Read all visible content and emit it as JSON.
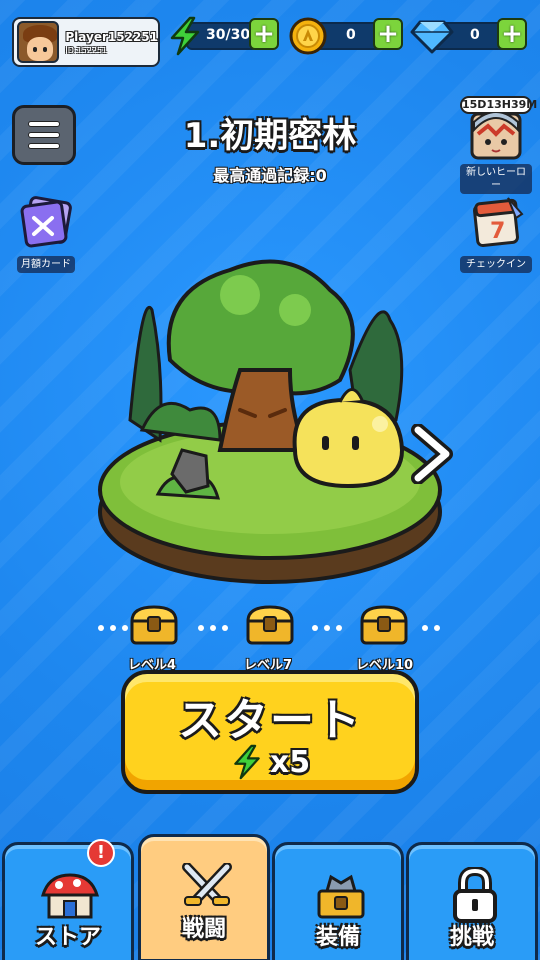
{
  "player": {
    "name": "Player152251",
    "id": "ID:152251"
  },
  "resources": {
    "energy": {
      "value": "30/30",
      "icon": "lightning-icon"
    },
    "gold": {
      "value": "0",
      "icon": "coin-icon"
    },
    "gems": {
      "value": "0",
      "icon": "diamond-icon"
    },
    "plus": "+"
  },
  "stage": {
    "title": "1.初期密林",
    "subtitle": "最高通過記録:0"
  },
  "side_left": {
    "monthly_card": "月額カード"
  },
  "side_right": {
    "timer": "15D13H39M",
    "new_hero": "新しいヒーロー",
    "checkin": "チェックイン"
  },
  "level_track": {
    "levels": [
      "レベル4",
      "レベル7",
      "レベル10"
    ]
  },
  "start_button": {
    "label": "スタート",
    "cost": "x5"
  },
  "nav": {
    "tabs": [
      {
        "label": "ストア",
        "icon": "shop-icon",
        "active": false,
        "alert": "!"
      },
      {
        "label": "戦闘",
        "icon": "crossed-swords-icon",
        "active": true
      },
      {
        "label": "装備",
        "icon": "equipment-chest-icon",
        "active": false
      },
      {
        "label": "挑戦",
        "icon": "lock-icon",
        "active": false
      }
    ]
  },
  "colors": {
    "background": "#1e88f0",
    "start_button": "#ffd21e",
    "active_tab": "#ffcc80",
    "tab": "#2a9cf7",
    "plus_button": "#7cd43c"
  }
}
